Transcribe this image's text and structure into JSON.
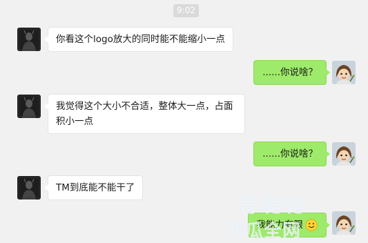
{
  "timestamp": "9:02",
  "messages": [
    {
      "side": "in",
      "text": "你看这个logo放大的同时能不能缩小一点"
    },
    {
      "side": "out",
      "text": "......你说啥？"
    },
    {
      "side": "in",
      "lines": [
        "我觉得这个大小不合适，整体大一点，占面",
        "积小一点"
      ]
    },
    {
      "side": "out",
      "text": "......你说啥？"
    },
    {
      "side": "in",
      "text": "TM到底能不能干了"
    },
    {
      "side": "out",
      "text": "我能力有限",
      "emoji": "smile-emoji"
    }
  ],
  "avatars": {
    "left": "dark-portrait-avatar",
    "right": "cartoon-girl-avatar"
  },
  "watermark": {
    "line1": "青缇缇",
    "line2": "西瓜全网"
  },
  "colors": {
    "outgoing_bubble": "#9eea6a",
    "incoming_bubble": "#ffffff",
    "background": "#f1f1f1"
  }
}
